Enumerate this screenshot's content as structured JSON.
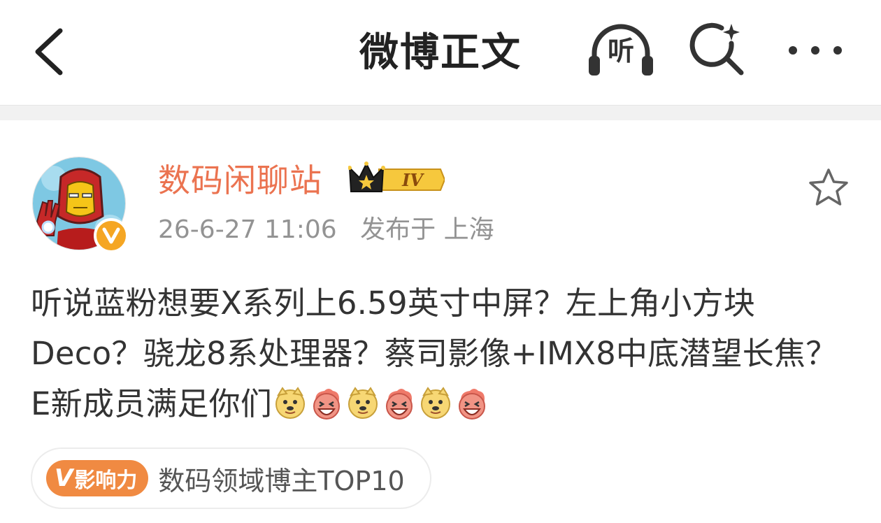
{
  "nav": {
    "title": "微博正文",
    "listen_label": "听",
    "icons": {
      "back": "chevron-left-icon",
      "listen": "headphones-icon",
      "search": "search-sparkle-icon",
      "more": "more-dots-icon"
    }
  },
  "post": {
    "author": {
      "name": "数码闲聊站",
      "verified_badge": "V",
      "vip_level": "IV"
    },
    "timestamp": "26-6-27 11:06",
    "location": "发布于 上海",
    "text_segments": [
      "听说蓝粉想要X系列上6.59英寸中屏？左上角小方块Deco？骁龙8系处理器？蔡司影像+IMX8中底潜望长焦？E新成员满足你们"
    ],
    "emojis": [
      "doge",
      "haha",
      "doge",
      "haha",
      "doge",
      "haha"
    ],
    "influence": {
      "badge_v": "V",
      "badge_label": "影响力",
      "text": "数码领域博主TOP10"
    }
  },
  "colors": {
    "username": "#eb7350",
    "meta": "#939393",
    "body_text": "#333333",
    "influence_badge": "#f08a42",
    "separator": "#f1f1f1"
  }
}
